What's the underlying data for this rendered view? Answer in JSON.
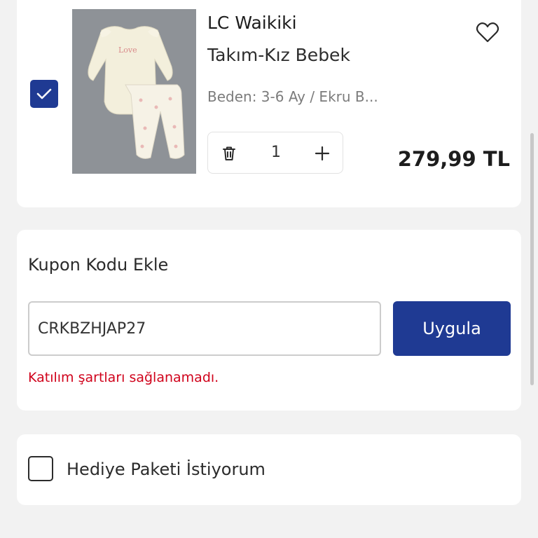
{
  "product": {
    "selected": true,
    "brand": "LC Waikiki",
    "name": "Takım-Kız Bebek",
    "variant": "Beden: 3-6 Ay / Ekru B...",
    "image_text": "Love",
    "quantity": "1",
    "price": "279,99 TL"
  },
  "coupon": {
    "title": "Kupon Kodu Ekle",
    "code_value": "CRKBZHJAP27",
    "apply_label": "Uygula",
    "error": "Katılım şartları sağlanamadı."
  },
  "gift": {
    "label": "Hediye Paketi İstiyorum",
    "checked": false
  },
  "colors": {
    "accent": "#1f3a93",
    "error": "#d0021b",
    "background": "#f2f2f2"
  },
  "icons": {
    "select": "checkmark-icon",
    "favorite": "heart-icon",
    "delete": "trash-icon",
    "increase": "plus-icon"
  }
}
